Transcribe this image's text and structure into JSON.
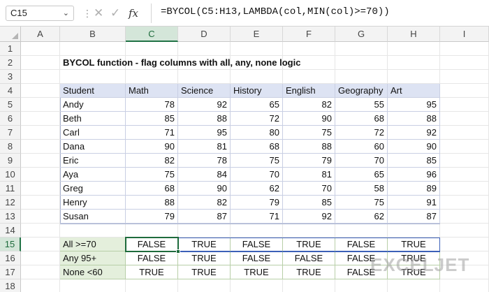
{
  "formula_bar": {
    "name_box": "C15",
    "formula": "=BYCOL(C5:H13,LAMBDA(col,MIN(col)>=70))"
  },
  "columns": [
    "A",
    "B",
    "C",
    "D",
    "E",
    "F",
    "G",
    "H",
    "I"
  ],
  "rows": [
    "1",
    "2",
    "3",
    "4",
    "5",
    "6",
    "7",
    "8",
    "9",
    "10",
    "11",
    "12",
    "13",
    "14",
    "15",
    "16",
    "17",
    "18"
  ],
  "title": "BYCOL function - flag columns with all, any, none logic",
  "table": {
    "headers": [
      "Student",
      "Math",
      "Science",
      "History",
      "English",
      "Geography",
      "Art"
    ],
    "rows": [
      [
        "Andy",
        "78",
        "92",
        "65",
        "82",
        "55",
        "95"
      ],
      [
        "Beth",
        "85",
        "88",
        "72",
        "90",
        "68",
        "88"
      ],
      [
        "Carl",
        "71",
        "95",
        "80",
        "75",
        "72",
        "92"
      ],
      [
        "Dana",
        "90",
        "81",
        "68",
        "88",
        "60",
        "90"
      ],
      [
        "Eric",
        "82",
        "78",
        "75",
        "79",
        "70",
        "85"
      ],
      [
        "Aya",
        "75",
        "84",
        "70",
        "81",
        "65",
        "96"
      ],
      [
        "Greg",
        "68",
        "90",
        "62",
        "70",
        "58",
        "89"
      ],
      [
        "Henry",
        "88",
        "82",
        "79",
        "85",
        "75",
        "91"
      ],
      [
        "Susan",
        "79",
        "87",
        "71",
        "92",
        "62",
        "87"
      ]
    ]
  },
  "results": [
    {
      "label": "All >=70",
      "values": [
        "FALSE",
        "TRUE",
        "FALSE",
        "TRUE",
        "FALSE",
        "TRUE"
      ]
    },
    {
      "label": "Any 95+",
      "values": [
        "FALSE",
        "TRUE",
        "FALSE",
        "FALSE",
        "FALSE",
        "TRUE"
      ]
    },
    {
      "label": "None <60",
      "values": [
        "TRUE",
        "TRUE",
        "TRUE",
        "TRUE",
        "FALSE",
        "TRUE"
      ]
    }
  ],
  "watermark": "EXCELJET"
}
